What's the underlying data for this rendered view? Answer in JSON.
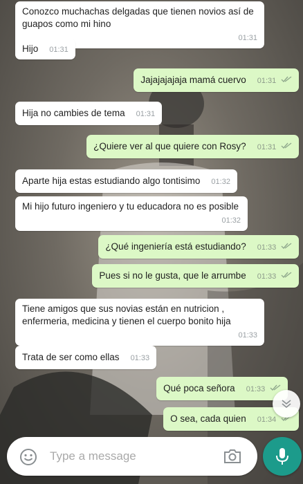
{
  "messages": [
    {
      "text": "Conozco muchachas delgadas que tienen novios así de guapos como mi hino",
      "time": "01:31",
      "direction": "incoming"
    },
    {
      "text": "Hijo",
      "time": "01:31",
      "direction": "incoming"
    },
    {
      "text": "Jajajajajaja mamá cuervo",
      "time": "01:31",
      "direction": "outgoing"
    },
    {
      "text": "Hija no cambies de tema",
      "time": "01:31",
      "direction": "incoming"
    },
    {
      "text": "¿Quiere ver al que quiere con Rosy?",
      "time": "01:31",
      "direction": "outgoing"
    },
    {
      "text": "Aparte hija estas estudiando algo tontisimo",
      "time": "01:32",
      "direction": "incoming"
    },
    {
      "text": "Mi hijo futuro ingeniero y tu educadora no es posible",
      "time": "01:32",
      "direction": "incoming"
    },
    {
      "text": "¿Qué ingeniería está estudiando?",
      "time": "01:33",
      "direction": "outgoing"
    },
    {
      "text": "Pues si no le gusta, que le arrumbe",
      "time": "01:33",
      "direction": "outgoing"
    },
    {
      "text": "Tiene amigos que sus novias están en nutricion , enfermeria, medicina y tienen el cuerpo bonito hija",
      "time": "01:33",
      "direction": "incoming"
    },
    {
      "text": "Trata de ser como ellas",
      "time": "01:33",
      "direction": "incoming"
    },
    {
      "text": "Qué poca señora",
      "time": "01:33",
      "direction": "outgoing"
    },
    {
      "text": "O sea, cada quien",
      "time": "01:34",
      "direction": "outgoing"
    }
  ],
  "composer": {
    "placeholder": "Type a message"
  },
  "icons": {
    "emoji": "emoji-icon",
    "camera": "camera-icon",
    "mic": "mic-icon",
    "scroll_down": "chevron-down-icon",
    "read_receipt": "double-check-icon"
  },
  "colors": {
    "incoming_bubble": "#ffffff",
    "outgoing_bubble": "#dcf8c6",
    "mic_button": "#1c9b8b"
  }
}
